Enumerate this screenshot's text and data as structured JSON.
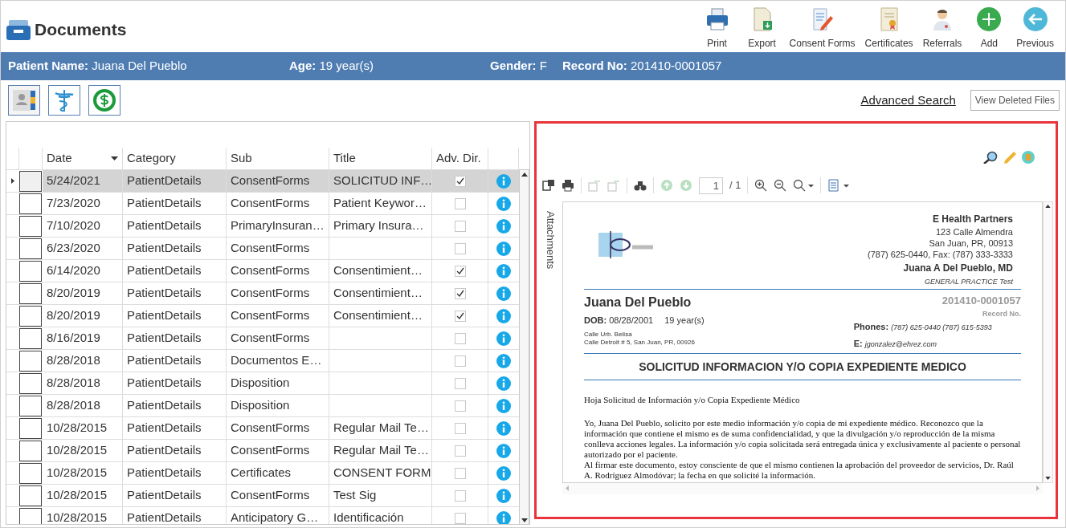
{
  "header": {
    "title": "Documents",
    "toolbar": [
      {
        "kind": "print",
        "label": "Print"
      },
      {
        "kind": "export",
        "label": "Export"
      },
      {
        "kind": "consent",
        "label": "Consent Forms"
      },
      {
        "kind": "certificate",
        "label": "Certificates"
      },
      {
        "kind": "referral",
        "label": "Referrals"
      },
      {
        "kind": "add",
        "label": "Add"
      },
      {
        "kind": "previous",
        "label": "Previous"
      }
    ]
  },
  "patient_bar": [
    {
      "label": "Patient Name:",
      "value": "Juana Del Pueblo"
    },
    {
      "label": "Age:",
      "value": "19 year(s)"
    },
    {
      "label": "Gender:",
      "value": "F"
    },
    {
      "label": "Record No:",
      "value": "201410-0001057"
    }
  ],
  "links": {
    "advanced_search": "Advanced Search",
    "view_deleted": "View Deleted Files"
  },
  "grid": {
    "columns": [
      "Date",
      "Category",
      "Sub",
      "Title",
      "Adv. Dir."
    ],
    "rows": [
      {
        "date": "5/24/2021",
        "category": "PatientDetails",
        "sub": "ConsentForms",
        "title": "SOLICITUD INF…",
        "adv_dir": true,
        "selected": true
      },
      {
        "date": "7/23/2020",
        "category": "PatientDetails",
        "sub": "ConsentForms",
        "title": "Patient Keywor…",
        "adv_dir": false,
        "selected": false
      },
      {
        "date": "7/10/2020",
        "category": "PatientDetails",
        "sub": "PrimaryInsuran…",
        "title": "Primary Insura…",
        "adv_dir": false,
        "selected": false
      },
      {
        "date": "6/23/2020",
        "category": "PatientDetails",
        "sub": "ConsentForms",
        "title": "",
        "adv_dir": false,
        "selected": false
      },
      {
        "date": "6/14/2020",
        "category": "PatientDetails",
        "sub": "ConsentForms",
        "title": "Consentimient…",
        "adv_dir": true,
        "selected": false
      },
      {
        "date": "8/20/2019",
        "category": "PatientDetails",
        "sub": "ConsentForms",
        "title": "Consentimient…",
        "adv_dir": true,
        "selected": false
      },
      {
        "date": "8/20/2019",
        "category": "PatientDetails",
        "sub": "ConsentForms",
        "title": "Consentimient…",
        "adv_dir": true,
        "selected": false
      },
      {
        "date": "8/16/2019",
        "category": "PatientDetails",
        "sub": "ConsentForms",
        "title": "",
        "adv_dir": false,
        "selected": false
      },
      {
        "date": "8/28/2018",
        "category": "PatientDetails",
        "sub": "Documentos E…",
        "title": "",
        "adv_dir": false,
        "selected": false
      },
      {
        "date": "8/28/2018",
        "category": "PatientDetails",
        "sub": "Disposition",
        "title": "",
        "adv_dir": false,
        "selected": false
      },
      {
        "date": "8/28/2018",
        "category": "PatientDetails",
        "sub": "Disposition",
        "title": "",
        "adv_dir": false,
        "selected": false
      },
      {
        "date": "10/28/2015",
        "category": "PatientDetails",
        "sub": "ConsentForms",
        "title": "Regular Mail Te…",
        "adv_dir": false,
        "selected": false
      },
      {
        "date": "10/28/2015",
        "category": "PatientDetails",
        "sub": "ConsentForms",
        "title": "Regular Mail Te…",
        "adv_dir": false,
        "selected": false
      },
      {
        "date": "10/28/2015",
        "category": "PatientDetails",
        "sub": "Certificates",
        "title": "CONSENT FORM",
        "adv_dir": false,
        "selected": false
      },
      {
        "date": "10/28/2015",
        "category": "PatientDetails",
        "sub": "ConsentForms",
        "title": "Test Sig",
        "adv_dir": false,
        "selected": false
      },
      {
        "date": "10/28/2015",
        "category": "PatientDetails",
        "sub": "Anticipatory G…",
        "title": "Identificación",
        "adv_dir": false,
        "selected": false
      }
    ]
  },
  "viewer": {
    "side_tab": "Attachments",
    "page_value": "1",
    "page_total": "/ 1",
    "document": {
      "clinic": "E Health Partners",
      "clinic_address": [
        "123 Calle Almendra",
        "San Juan, PR, 00913",
        "(787) 625-0440, Fax: (787) 333-3333"
      ],
      "doctor": "Juana A Del Pueblo, MD",
      "specialty": "GENERAL PRACTICE Test",
      "patient_name": "Juana Del Pueblo",
      "dob_label": "DOB:",
      "dob": "08/28/2001",
      "age": "19 year(s)",
      "address": [
        "Calle Urb. Belisa",
        "Calle Detroit # 5, San Juan, PR, 00926"
      ],
      "record_no": "201410-0001057",
      "record_label": "Record No.",
      "phones_label": "Phones:",
      "phones": "(787) 625-0440   (787) 615-5393",
      "email_label": "E:",
      "email": "jgonzalez@ehrez.com",
      "heading": "SOLICITUD INFORMACION Y/O COPIA EXPEDIENTE MEDICO",
      "subheading": "Hoja Solicitud de Información y/o Copia Expediente Médico",
      "paragraphs": [
        "Yo, Juana Del Pueblo, solicito por este medio información y/o copia de mi expediente médico. Reconozco que la información que contiene el mismo es de suma confidencialidad, y que la divulgación y/o reproducción de la misma conlleva acciones legales. La información y/o copia solicitada será entregada única y exclusivamente al paciente o personal autorizado por el paciente.",
        "Al firmar este documento, estoy consciente de que el mismo contienen la aprobación del proveedor de servicios, Dr. Raúl A. Rodríguez Almodóvar; la fecha en que solicité la información."
      ]
    }
  }
}
